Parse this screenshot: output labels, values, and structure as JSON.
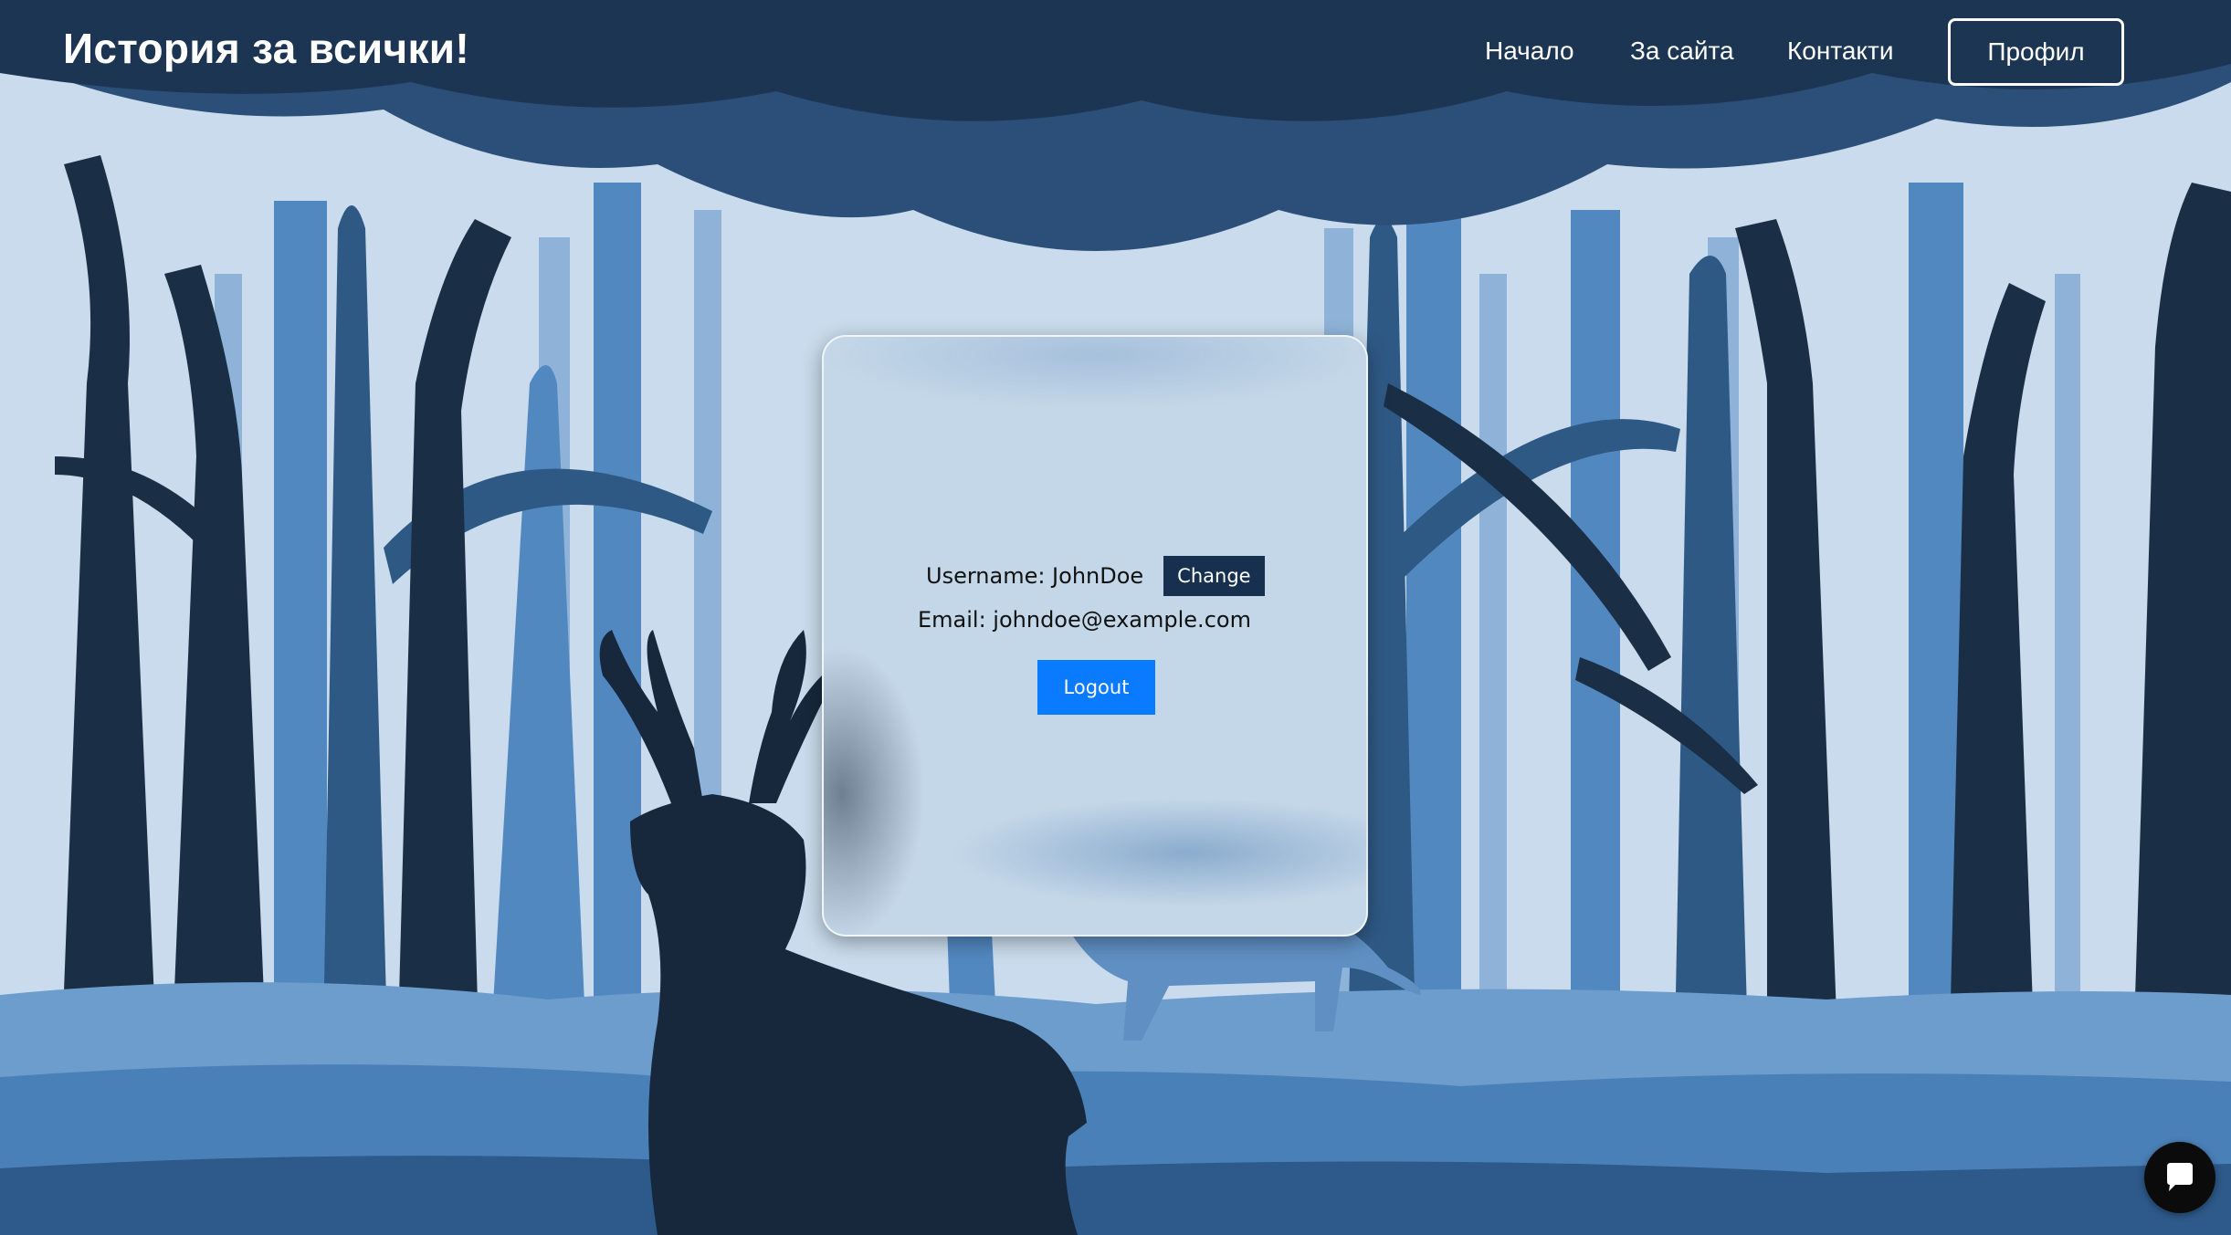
{
  "header": {
    "site_title": "История за всички!",
    "nav": [
      {
        "label": "Начало"
      },
      {
        "label": "За сайта"
      },
      {
        "label": "Контакти"
      }
    ],
    "profile_label": "Профил"
  },
  "profile_card": {
    "username_text": "Username: JohnDoe",
    "change_label": "Change",
    "email_text": "Email: johndoe@example.com",
    "logout_label": "Logout"
  },
  "chat": {
    "icon": "chat-bubble-icon"
  },
  "colors": {
    "header_bg": "#16263a",
    "forest_dark": "#1a2e45",
    "forest_mid": "#2d5580",
    "forest_light": "#4f86bd",
    "sky": "#c9dbec",
    "change_button": "#18304f",
    "logout_button": "#0a7bff"
  }
}
